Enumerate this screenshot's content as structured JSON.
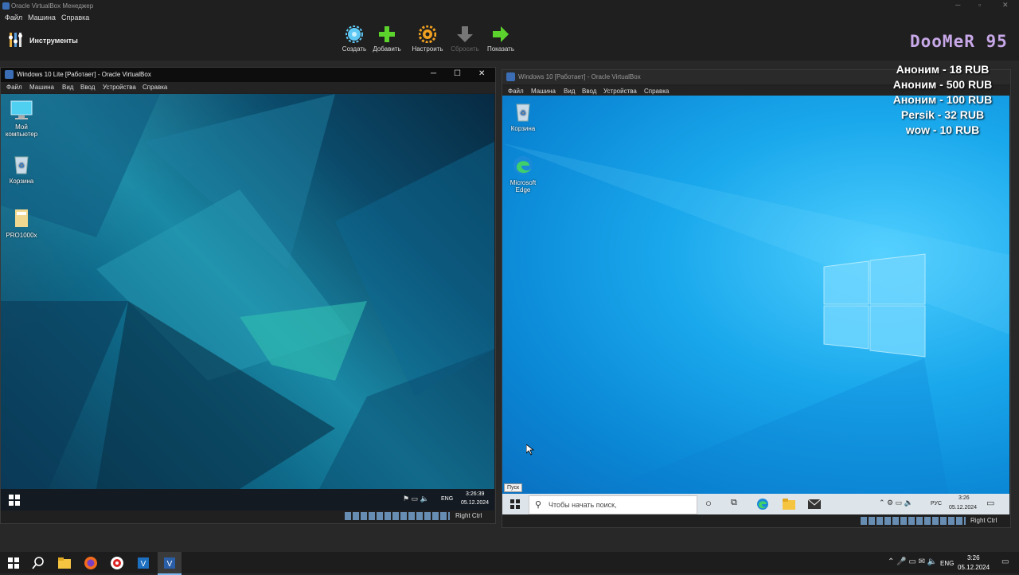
{
  "manager": {
    "title": "Oracle VirtualBox Менеджер",
    "menu": [
      "Файл",
      "Машина",
      "Справка"
    ],
    "tools_label": "Инструменты",
    "toolbar": [
      {
        "label": "Создать",
        "icon": "gear-blue-icon",
        "enabled": true
      },
      {
        "label": "Добавить",
        "icon": "plus-icon",
        "enabled": true
      },
      {
        "label": "Настроить",
        "icon": "settings-icon",
        "enabled": true
      },
      {
        "label": "Сбросить",
        "icon": "arrow-down-icon",
        "enabled": false
      },
      {
        "label": "Показать",
        "icon": "arrow-right-icon",
        "enabled": true
      }
    ]
  },
  "brand": "DooMeR 95",
  "donations": [
    "Аноним - 18 RUB",
    "Аноним - 500 RUB",
    "Аноним - 100 RUB",
    "Persik - 32 RUB",
    "wow - 10 RUB"
  ],
  "vm_left": {
    "title": "Windows 10 Lite [Работает] - Oracle VirtualBox",
    "menu": [
      "Файл",
      "Машина",
      "Вид",
      "Ввод",
      "Устройства",
      "Справка"
    ],
    "desktop_icons": [
      {
        "label_line1": "Мой",
        "label_line2": "компьютер",
        "icon": "computer-icon"
      },
      {
        "label_line1": "Корзина",
        "label_line2": "",
        "icon": "recycle-bin-icon"
      },
      {
        "label_line1": "PRO1000x",
        "label_line2": "",
        "icon": "folder-icon"
      }
    ],
    "tray_lang": "ENG",
    "time": "3:26:39",
    "date": "05.12.2024",
    "host_key": "Right Ctrl"
  },
  "vm_right": {
    "title": "Windows 10 [Работает] - Oracle VirtualBox",
    "menu": [
      "Файл",
      "Машина",
      "Вид",
      "Ввод",
      "Устройства",
      "Справка"
    ],
    "desktop_icons": [
      {
        "label_line1": "Корзина",
        "label_line2": "",
        "icon": "recycle-bin-icon"
      },
      {
        "label_line1": "Microsoft",
        "label_line2": "Edge",
        "icon": "edge-icon"
      }
    ],
    "start_tooltip": "Пуск",
    "search_placeholder": "Чтобы начать поиск,",
    "tray_lang": "РУС",
    "time": "3:26",
    "date": "05.12.2024",
    "host_key": "Right Ctrl"
  },
  "host_taskbar": {
    "lang": "ENG",
    "time": "3:26",
    "date": "05.12.2024"
  }
}
